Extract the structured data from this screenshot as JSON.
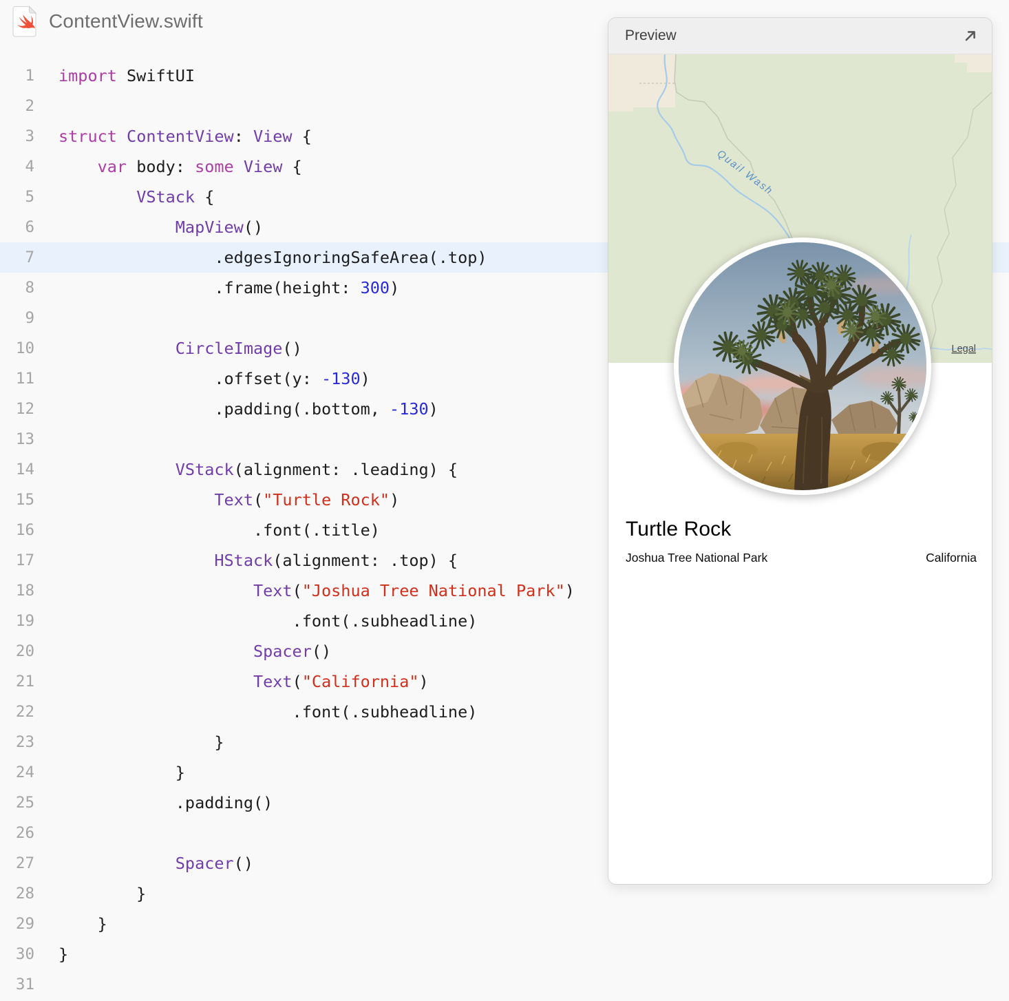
{
  "header": {
    "filename": "ContentView.swift"
  },
  "code": {
    "lines": [
      {
        "n": 1,
        "highlight": false,
        "tokens": [
          {
            "c": "k",
            "t": "import"
          },
          {
            "c": "p",
            "t": " SwiftUI"
          }
        ]
      },
      {
        "n": 2,
        "highlight": false,
        "tokens": []
      },
      {
        "n": 3,
        "highlight": false,
        "tokens": [
          {
            "c": "k",
            "t": "struct"
          },
          {
            "c": "p",
            "t": " "
          },
          {
            "c": "ty",
            "t": "ContentView"
          },
          {
            "c": "p",
            "t": ": "
          },
          {
            "c": "ty",
            "t": "View"
          },
          {
            "c": "p",
            "t": " {"
          }
        ]
      },
      {
        "n": 4,
        "highlight": false,
        "tokens": [
          {
            "c": "p",
            "t": "    "
          },
          {
            "c": "k",
            "t": "var"
          },
          {
            "c": "p",
            "t": " body: "
          },
          {
            "c": "k",
            "t": "some"
          },
          {
            "c": "p",
            "t": " "
          },
          {
            "c": "ty",
            "t": "View"
          },
          {
            "c": "p",
            "t": " {"
          }
        ]
      },
      {
        "n": 5,
        "highlight": false,
        "tokens": [
          {
            "c": "p",
            "t": "        "
          },
          {
            "c": "ty",
            "t": "VStack"
          },
          {
            "c": "p",
            "t": " {"
          }
        ]
      },
      {
        "n": 6,
        "highlight": false,
        "tokens": [
          {
            "c": "p",
            "t": "            "
          },
          {
            "c": "ty",
            "t": "MapView"
          },
          {
            "c": "p",
            "t": "()"
          }
        ]
      },
      {
        "n": 7,
        "highlight": true,
        "tokens": [
          {
            "c": "p",
            "t": "                .edgesIgnoringSafeArea(.top)"
          }
        ]
      },
      {
        "n": 8,
        "highlight": false,
        "tokens": [
          {
            "c": "p",
            "t": "                .frame(height: "
          },
          {
            "c": "num",
            "t": "300"
          },
          {
            "c": "p",
            "t": ")"
          }
        ]
      },
      {
        "n": 9,
        "highlight": false,
        "tokens": []
      },
      {
        "n": 10,
        "highlight": false,
        "tokens": [
          {
            "c": "p",
            "t": "            "
          },
          {
            "c": "ty",
            "t": "CircleImage"
          },
          {
            "c": "p",
            "t": "()"
          }
        ]
      },
      {
        "n": 11,
        "highlight": false,
        "tokens": [
          {
            "c": "p",
            "t": "                .offset(y: "
          },
          {
            "c": "num",
            "t": "-130"
          },
          {
            "c": "p",
            "t": ")"
          }
        ]
      },
      {
        "n": 12,
        "highlight": false,
        "tokens": [
          {
            "c": "p",
            "t": "                .padding(.bottom, "
          },
          {
            "c": "num",
            "t": "-130"
          },
          {
            "c": "p",
            "t": ")"
          }
        ]
      },
      {
        "n": 13,
        "highlight": false,
        "tokens": []
      },
      {
        "n": 14,
        "highlight": false,
        "tokens": [
          {
            "c": "p",
            "t": "            "
          },
          {
            "c": "ty",
            "t": "VStack"
          },
          {
            "c": "p",
            "t": "(alignment: .leading) {"
          }
        ]
      },
      {
        "n": 15,
        "highlight": false,
        "tokens": [
          {
            "c": "p",
            "t": "                "
          },
          {
            "c": "ty",
            "t": "Text"
          },
          {
            "c": "p",
            "t": "("
          },
          {
            "c": "str",
            "t": "\"Turtle Rock\""
          },
          {
            "c": "p",
            "t": ")"
          }
        ]
      },
      {
        "n": 16,
        "highlight": false,
        "tokens": [
          {
            "c": "p",
            "t": "                    .font(.title)"
          }
        ]
      },
      {
        "n": 17,
        "highlight": false,
        "tokens": [
          {
            "c": "p",
            "t": "                "
          },
          {
            "c": "ty",
            "t": "HStack"
          },
          {
            "c": "p",
            "t": "(alignment: .top) {"
          }
        ]
      },
      {
        "n": 18,
        "highlight": false,
        "tokens": [
          {
            "c": "p",
            "t": "                    "
          },
          {
            "c": "ty",
            "t": "Text"
          },
          {
            "c": "p",
            "t": "("
          },
          {
            "c": "str",
            "t": "\"Joshua Tree National Park\""
          },
          {
            "c": "p",
            "t": ")"
          }
        ]
      },
      {
        "n": 19,
        "highlight": false,
        "tokens": [
          {
            "c": "p",
            "t": "                        .font(.subheadline)"
          }
        ]
      },
      {
        "n": 20,
        "highlight": false,
        "tokens": [
          {
            "c": "p",
            "t": "                    "
          },
          {
            "c": "ty",
            "t": "Spacer"
          },
          {
            "c": "p",
            "t": "()"
          }
        ]
      },
      {
        "n": 21,
        "highlight": false,
        "tokens": [
          {
            "c": "p",
            "t": "                    "
          },
          {
            "c": "ty",
            "t": "Text"
          },
          {
            "c": "p",
            "t": "("
          },
          {
            "c": "str",
            "t": "\"California\""
          },
          {
            "c": "p",
            "t": ")"
          }
        ]
      },
      {
        "n": 22,
        "highlight": false,
        "tokens": [
          {
            "c": "p",
            "t": "                        .font(.subheadline)"
          }
        ]
      },
      {
        "n": 23,
        "highlight": false,
        "tokens": [
          {
            "c": "p",
            "t": "                }"
          }
        ]
      },
      {
        "n": 24,
        "highlight": false,
        "tokens": [
          {
            "c": "p",
            "t": "            }"
          }
        ]
      },
      {
        "n": 25,
        "highlight": false,
        "tokens": [
          {
            "c": "p",
            "t": "            .padding()"
          }
        ]
      },
      {
        "n": 26,
        "highlight": false,
        "tokens": []
      },
      {
        "n": 27,
        "highlight": false,
        "tokens": [
          {
            "c": "p",
            "t": "            "
          },
          {
            "c": "ty",
            "t": "Spacer"
          },
          {
            "c": "p",
            "t": "()"
          }
        ]
      },
      {
        "n": 28,
        "highlight": false,
        "tokens": [
          {
            "c": "p",
            "t": "        }"
          }
        ]
      },
      {
        "n": 29,
        "highlight": false,
        "tokens": [
          {
            "c": "p",
            "t": "    }"
          }
        ]
      },
      {
        "n": 30,
        "highlight": false,
        "tokens": [
          {
            "c": "p",
            "t": "}"
          }
        ]
      },
      {
        "n": 31,
        "highlight": false,
        "tokens": []
      }
    ]
  },
  "preview": {
    "title": "Preview",
    "map": {
      "stream_label": "Quail Wash",
      "legal": "Legal"
    },
    "card": {
      "title": "Turtle Rock",
      "park": "Joshua Tree National Park",
      "state": "California"
    }
  },
  "colors": {
    "page-bg": "#f9f9f9",
    "highlight": "#e9f1fc",
    "keyword": "#ad3da4",
    "type": "#703daa",
    "string": "#d12f1b",
    "number": "#272ad8",
    "plain": "#1d1d1f",
    "lineno": "#a5a5a5",
    "map-green": "#e0e7d0",
    "map-sand": "#efeadc",
    "map-stream": "#a6cbe9",
    "swift-orange": "#ee5138"
  }
}
